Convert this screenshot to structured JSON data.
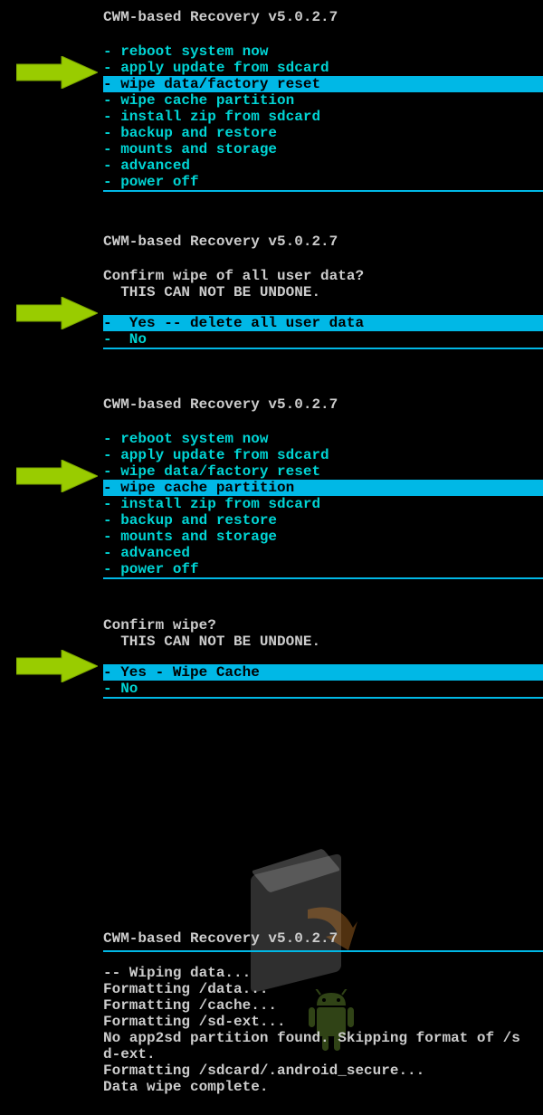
{
  "screens": [
    {
      "title": "CWM-based Recovery v5.0.2.7",
      "items": [
        "- reboot system now",
        "- apply update from sdcard",
        "- wipe data/factory reset",
        "- wipe cache partition",
        "- install zip from sdcard",
        "- backup and restore",
        "- mounts and storage",
        "- advanced",
        "- power off"
      ],
      "selected_index": 2
    },
    {
      "title": "CWM-based Recovery v5.0.2.7",
      "prompt": "Confirm wipe of all user data?",
      "warning": "  THIS CAN NOT BE UNDONE.",
      "items": [
        "-  Yes -- delete all user data",
        "-  No"
      ],
      "selected_index": 0
    },
    {
      "title": "CWM-based Recovery v5.0.2.7",
      "items": [
        "- reboot system now",
        "- apply update from sdcard",
        "- wipe data/factory reset",
        "- wipe cache partition",
        "- install zip from sdcard",
        "- backup and restore",
        "- mounts and storage",
        "- advanced",
        "- power off"
      ],
      "selected_index": 3
    },
    {
      "prompt": "Confirm wipe?",
      "warning": "  THIS CAN NOT BE UNDONE.",
      "items": [
        "- Yes - Wipe Cache",
        "- No"
      ],
      "selected_index": 0
    },
    {
      "title": "CWM-based Recovery v5.0.2.7",
      "log": [
        "-- Wiping data...",
        "Formatting /data...",
        "Formatting /cache...",
        "Formatting /sd-ext...",
        "No app2sd partition found. Skipping format of /s",
        "d-ext.",
        "Formatting /sdcard/.android_secure...",
        "Data wipe complete."
      ]
    }
  ]
}
